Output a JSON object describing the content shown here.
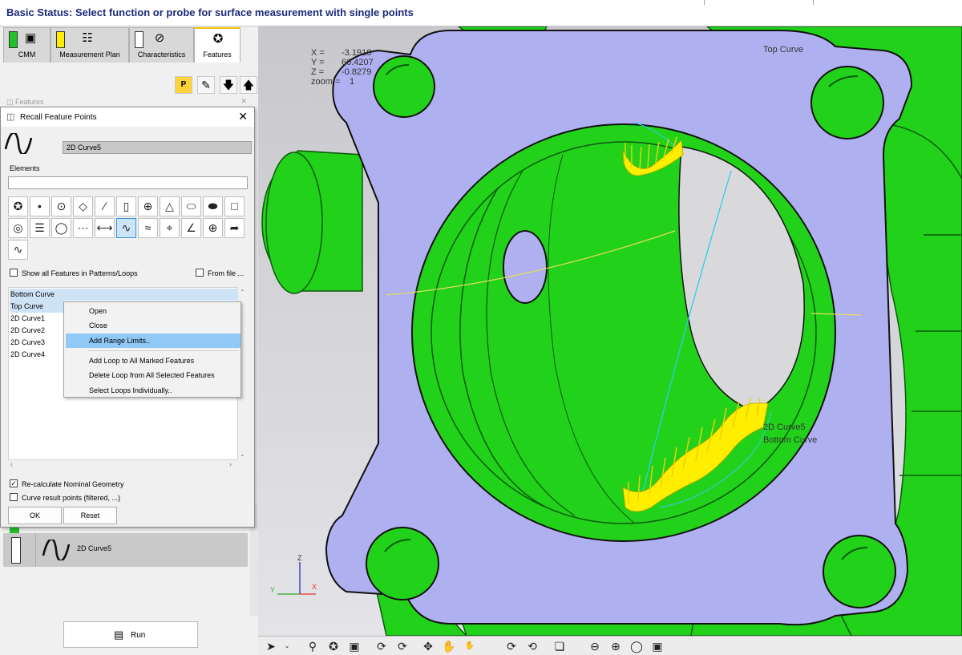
{
  "title_bar": {
    "text": "Basic Status: Select function or probe for surface measurement with single points"
  },
  "tabs": [
    {
      "label": "CMM",
      "indicator_color": "#22c02a",
      "icon": "cmm-icon"
    },
    {
      "label": "Measurement Plan",
      "indicator_color": "#ffee00",
      "icon": "plan-icon"
    },
    {
      "label": "Characteristics",
      "indicator_color": "#ffffff",
      "icon": "characteristics-icon"
    },
    {
      "label": "Features",
      "icon": "features-icon",
      "active": true
    }
  ],
  "features_panel": {
    "label": "Features"
  },
  "dialog": {
    "title": "Recall Feature Points",
    "feature_name": "2D Curve5",
    "elements_label": "Elements",
    "elements_value": "",
    "show_all_label": "Show all Features in Patterns/Loops",
    "from_file_label": "From file ...",
    "list_items": [
      "Bottom Curve",
      "Top Curve",
      "2D Curve1",
      "2D Curve2",
      "2D Curve3",
      "2D Curve4"
    ],
    "recalc_label": "Re-calculate Nominal Geometry",
    "recalc_checked": true,
    "curve_result_label": "Curve result points (filtered, ...)",
    "curve_result_checked": false,
    "ok_label": "OK",
    "reset_label": "Reset"
  },
  "context_menu": {
    "items": [
      "Open",
      "Close",
      "Add Range Limits..",
      "Add Loop to All Marked Features",
      "Delete Loop from All Selected Features",
      "Select Loops Individually.."
    ],
    "highlighted": "Add Range Limits.."
  },
  "feature_item": {
    "label": "2D Curve5"
  },
  "run_button": {
    "label": "Run"
  },
  "viewport": {
    "coords": {
      "x_label": "X =",
      "x": "-3.1918",
      "y_label": "Y =",
      "y": "60.4207",
      "z_label": "Z =",
      "z": "-0.8279",
      "zoom_label": "zoom =",
      "zoom": "1"
    },
    "label_top_curve": "Top Curve",
    "label_2d_curve5": "2D Curve5",
    "label_bottom_curve": "Bottom Curve",
    "axis_z": "Z",
    "axis_x": "X",
    "axis_y": "Y"
  },
  "colors": {
    "part_green": "#22d11a",
    "flange_lavender": "#aeb0f0",
    "accent_yellow": "#ffee00",
    "selection_blue": "#90c8f6"
  }
}
